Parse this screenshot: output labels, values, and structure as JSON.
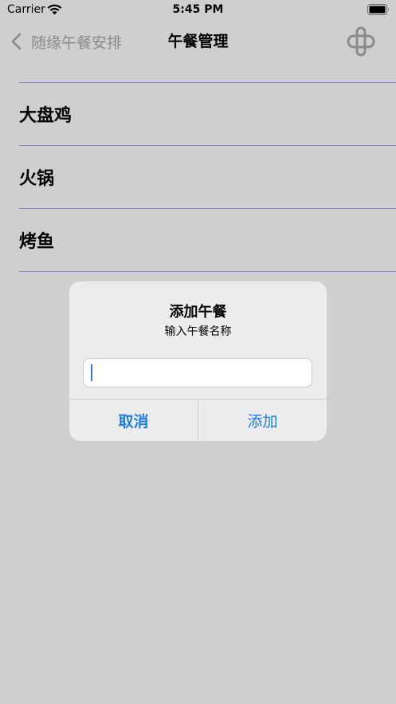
{
  "status_bar": {
    "carrier": "Carrier",
    "time": "5:45 PM",
    "wifi_icon": "wifi-icon",
    "battery_icon": "battery-icon"
  },
  "nav": {
    "back_label": "随缘午餐安排",
    "title": "午餐管理",
    "right_icon": "weight-icon"
  },
  "list": {
    "items": [
      {
        "label": "大盘鸡"
      },
      {
        "label": "火锅"
      },
      {
        "label": "烤鱼"
      }
    ]
  },
  "alert": {
    "title": "添加午餐",
    "message": "输入午餐名称",
    "input_value": "",
    "input_placeholder": "",
    "cancel_label": "取消",
    "confirm_label": "添加"
  },
  "colors": {
    "background": "#cfcfcf",
    "divider": "#8a86d8",
    "accent": "#1f7de0"
  }
}
